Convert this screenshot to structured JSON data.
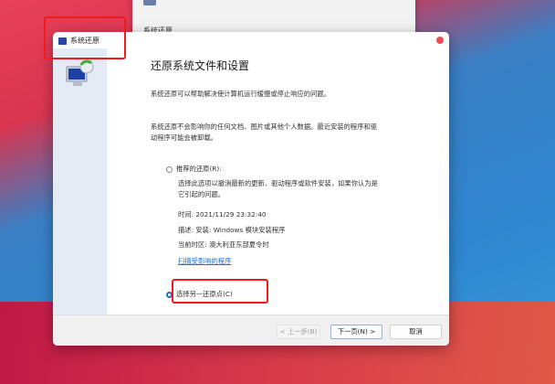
{
  "background_window": {
    "title": "系统还原"
  },
  "dialog": {
    "title": "系统还原",
    "heading": "还原系统文件和设置",
    "intro": "系统还原可以帮助解决使计算机运行缓慢或停止响应的问题。",
    "note": "系统还原不会影响你的任何文档、图片或其他个人数据。最近安装的程序和驱动程序可能会被卸载。",
    "recommended": {
      "label": "推荐的还原(R):",
      "selected": false,
      "description": "选择此选项以撤消最新的更新、驱动程序或软件安装，如果你认为是它引起的问题。",
      "time": "时间: 2021/11/29 23:32:40",
      "desc": "描述: 安装: Windows 模块安装程序",
      "timezone": "当前时区: 澳大利亚东部夏令时",
      "scan_link": "扫描受影响的程序"
    },
    "choose_other": {
      "label": "选择另一还原点(C)",
      "selected": true
    },
    "buttons": {
      "back": "< 上一步(B)",
      "next": "下一页(N) >",
      "cancel": "取消"
    }
  },
  "colors": {
    "highlight": "#f01c1c",
    "accent": "#1a6fc4"
  }
}
